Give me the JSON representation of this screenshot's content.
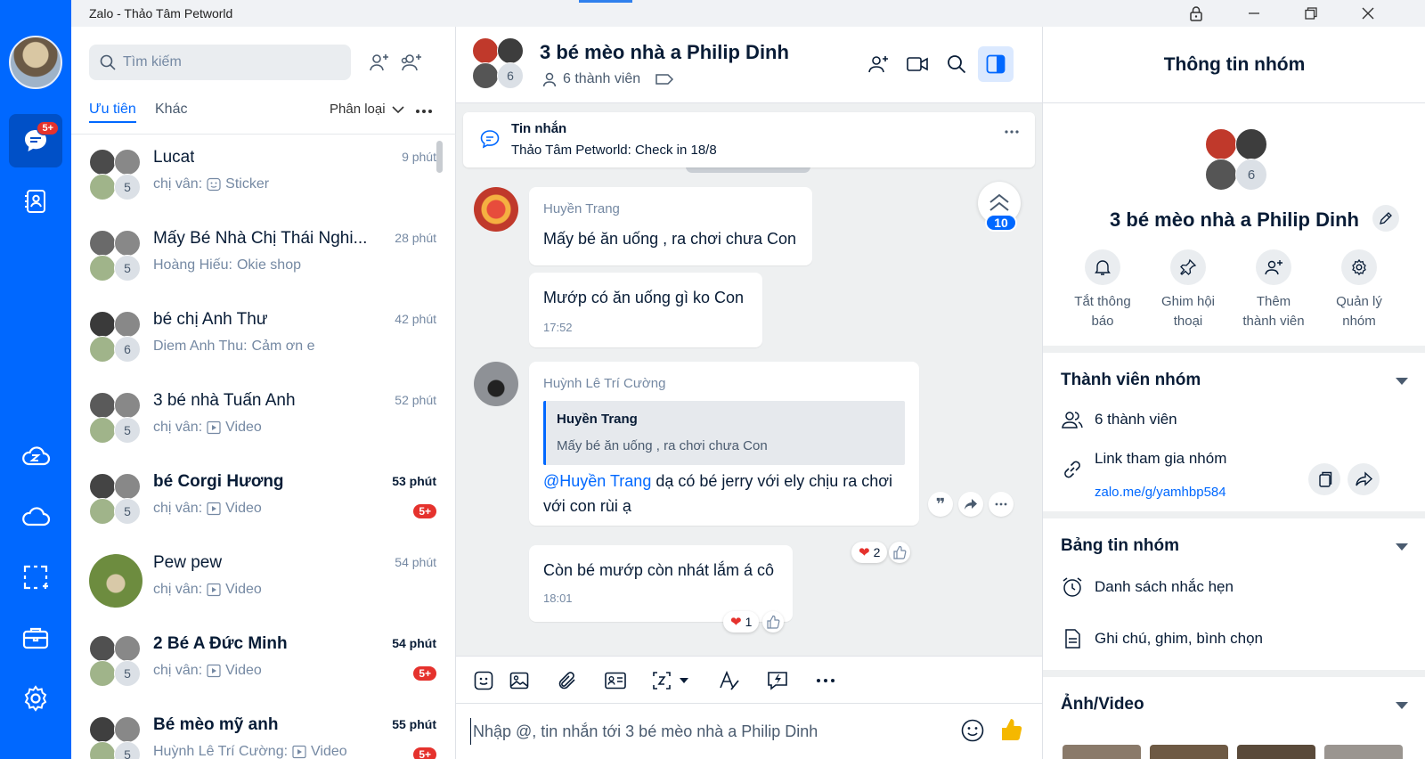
{
  "window": {
    "title": "Zalo - Thảo Tâm Petworld"
  },
  "nav": {
    "messages_badge": "5+"
  },
  "search": {
    "placeholder": "Tìm kiếm"
  },
  "tabs": {
    "priority": "Ưu tiên",
    "other": "Khác",
    "classify": "Phân loại"
  },
  "conversations": [
    {
      "name": "Lucat",
      "time": "9 phút",
      "preview_sender": "chị vân:",
      "preview_icon": "sticker-icon",
      "preview_text": "Sticker",
      "members": "5",
      "bold": false,
      "unread": ""
    },
    {
      "name": "Mấy Bé Nhà Chị Thái Nghi...",
      "time": "28 phút",
      "preview_sender": "Hoàng Hiếu:",
      "preview_icon": "",
      "preview_text": "Okie shop",
      "members": "5",
      "bold": false,
      "unread": ""
    },
    {
      "name": "bé chị Anh Thư",
      "time": "42 phút",
      "preview_sender": "Diem Anh Thu:",
      "preview_icon": "",
      "preview_text": "Cảm ơn e",
      "members": "6",
      "bold": false,
      "unread": ""
    },
    {
      "name": "3 bé nhà Tuấn Anh",
      "time": "52 phút",
      "preview_sender": "chị vân:",
      "preview_icon": "video-icon",
      "preview_text": "Video",
      "members": "5",
      "bold": false,
      "unread": ""
    },
    {
      "name": "bé Corgi Hương",
      "time": "53 phút",
      "preview_sender": "chị vân:",
      "preview_icon": "video-icon",
      "preview_text": "Video",
      "members": "5",
      "bold": true,
      "unread": "5+"
    },
    {
      "name": "Pew pew",
      "time": "54 phút",
      "preview_sender": "chị vân:",
      "preview_icon": "video-icon",
      "preview_text": "Video",
      "members": "",
      "bold": false,
      "unread": ""
    },
    {
      "name": "2 Bé A Đức Minh",
      "time": "54 phút",
      "preview_sender": "chị vân:",
      "preview_icon": "video-icon",
      "preview_text": "Video",
      "members": "5",
      "bold": true,
      "unread": "5+"
    },
    {
      "name": "Bé mèo mỹ anh",
      "time": "55 phút",
      "preview_sender": "Huỳnh Lê Trí Cường:",
      "preview_icon": "video-icon",
      "preview_text": "Video",
      "members": "5",
      "bold": true,
      "unread": "5+"
    }
  ],
  "chat": {
    "group_name": "3 bé mèo nhà a Philip Dinh",
    "member_count_label": "6 thành viên",
    "avatar_count": "6",
    "pinned_title": "Tin nhắn",
    "pinned_text": "Thảo Tâm Petworld: Check in 18/8",
    "jump_count": "10",
    "messages": [
      {
        "sender": "Huyền Trang",
        "text": "Mấy bé ăn uống , ra chơi chưa Con"
      },
      {
        "text": "Mướp có ăn uống gì ko Con",
        "time": "17:52"
      },
      {
        "sender": "Huỳnh Lê Trí Cường",
        "quote_name": "Huyền Trang",
        "quote_text": "Mấy bé ăn uống , ra chơi chưa Con",
        "mention": "@Huyền Trang",
        "text_line1": " dạ có bé jerry với ely chịu ra chơi",
        "text_line2": "với con rùi ạ",
        "reaction_count": "2"
      },
      {
        "text": "Còn bé mướp còn nhát lắm á cô",
        "time": "18:01",
        "reaction_count": "1"
      }
    ],
    "composer_placeholder": "Nhập @, tin nhắn tới 3 bé mèo nhà a Philip Dinh"
  },
  "info": {
    "title": "Thông tin nhóm",
    "group_name": "3 bé mèo nhà a Philip Dinh",
    "avatar_count": "6",
    "actions": [
      {
        "line1": "Tắt thông",
        "line2": "báo",
        "icon": "bell-icon"
      },
      {
        "line1": "Ghim hội",
        "line2": "thoại",
        "icon": "pin-icon"
      },
      {
        "line1": "Thêm",
        "line2": "thành viên",
        "icon": "add-member-icon"
      },
      {
        "line1": "Quản lý",
        "line2": "nhóm",
        "icon": "gear-icon"
      }
    ],
    "members_title": "Thành viên nhóm",
    "members_count": "6 thành viên",
    "link_label": "Link tham gia nhóm",
    "link_url": "zalo.me/g/yamhbp584",
    "board_title": "Bảng tin nhóm",
    "reminders": "Danh sách nhắc hẹn",
    "notes": "Ghi chú, ghim, bình chọn",
    "media_title": "Ảnh/Video"
  },
  "colors": {
    "brand": "#0068ff",
    "badge": "#e5322d"
  }
}
